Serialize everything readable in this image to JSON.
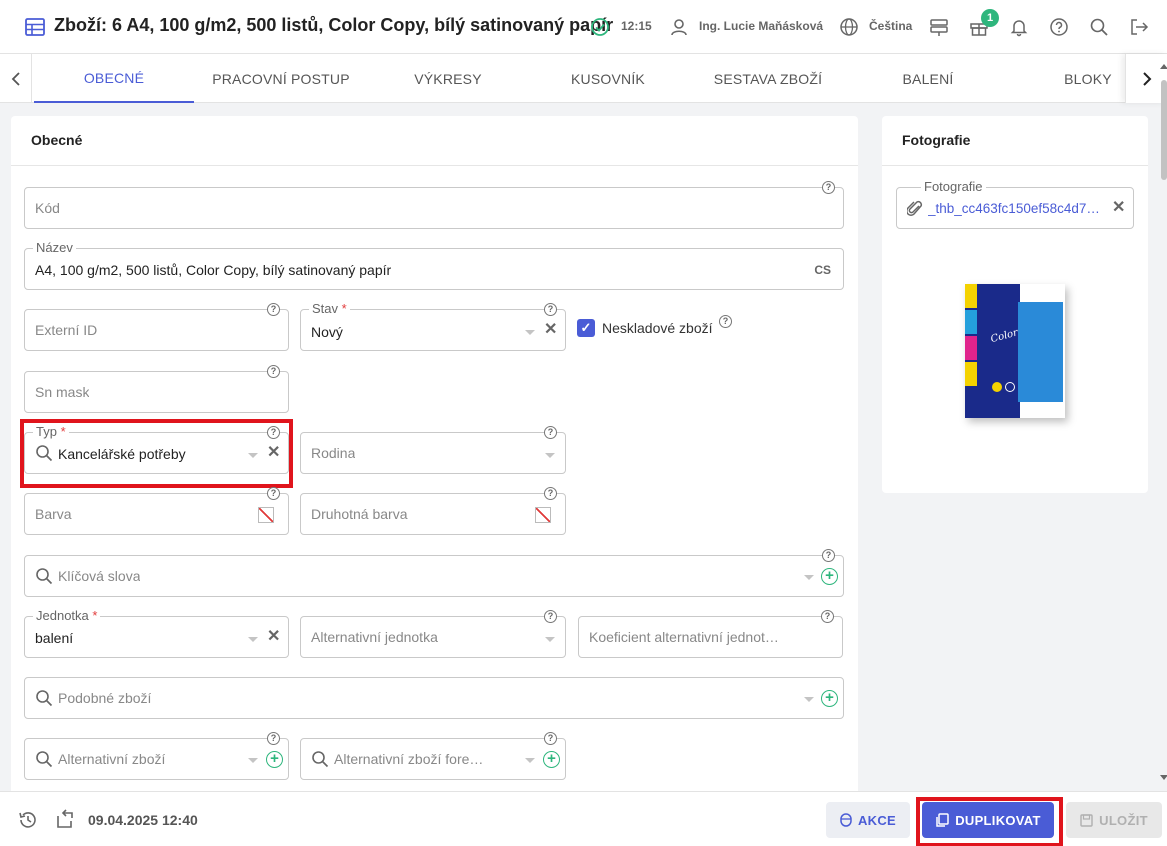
{
  "header": {
    "title": "Zboží: 6 A4, 100 g/m2, 500 listů, Color Copy, bílý satinovaný papír",
    "time": "12:15",
    "user": "Ing. Lucie Maňásková",
    "language": "Čeština",
    "gift_badge": "1"
  },
  "tabs": [
    {
      "label": "OBECNÉ"
    },
    {
      "label": "PRACOVNÍ POSTUP"
    },
    {
      "label": "VÝKRESY"
    },
    {
      "label": "KUSOVNÍK"
    },
    {
      "label": "SESTAVA ZBOŽÍ"
    },
    {
      "label": "BALENÍ"
    },
    {
      "label": "BLOKY"
    }
  ],
  "general": {
    "heading": "Obecné",
    "kod_placeholder": "Kód",
    "nazev_label": "Název",
    "nazev_value": "A4, 100 g/m2, 500 listů, Color Copy, bílý satinovaný papír",
    "nazev_lang": "CS",
    "externi_id_placeholder": "Externí ID",
    "stav_label": "Stav",
    "stav_value": "Nový",
    "neskladove_label": "Neskladové zboží",
    "sn_mask_placeholder": "Sn mask",
    "typ_label": "Typ",
    "typ_value": "Kancelářské potřeby",
    "rodina_placeholder": "Rodina",
    "barva_placeholder": "Barva",
    "druhotna_barva_placeholder": "Druhotná barva",
    "klicova_slova_placeholder": "Klíčová slova",
    "jednotka_label": "Jednotka",
    "jednotka_value": "balení",
    "alt_jednotka_placeholder": "Alternativní jednotka",
    "koeficient_placeholder": "Koeficient alternativní jednot…",
    "podobne_placeholder": "Podobné zboží",
    "alt_zbozi_placeholder": "Alternativní zboží",
    "alt_zbozi_fore_placeholder": "Alternativní zboží fore…",
    "required_mark": "*",
    "help_mark": "?"
  },
  "photo": {
    "heading": "Fotografie",
    "field_label": "Fotografie",
    "file_name": "_thb_cc463fc150ef58c4d7…"
  },
  "bottom": {
    "timestamp": "09.04.2025 12:40",
    "akce_label": "AKCE",
    "duplikovat_label": "DUPLIKOVAT",
    "ulozit_label": "ULOŽIT"
  },
  "colors": {
    "accent": "#4a5cd6",
    "green": "#2eb67d",
    "highlight": "#e0141c"
  }
}
